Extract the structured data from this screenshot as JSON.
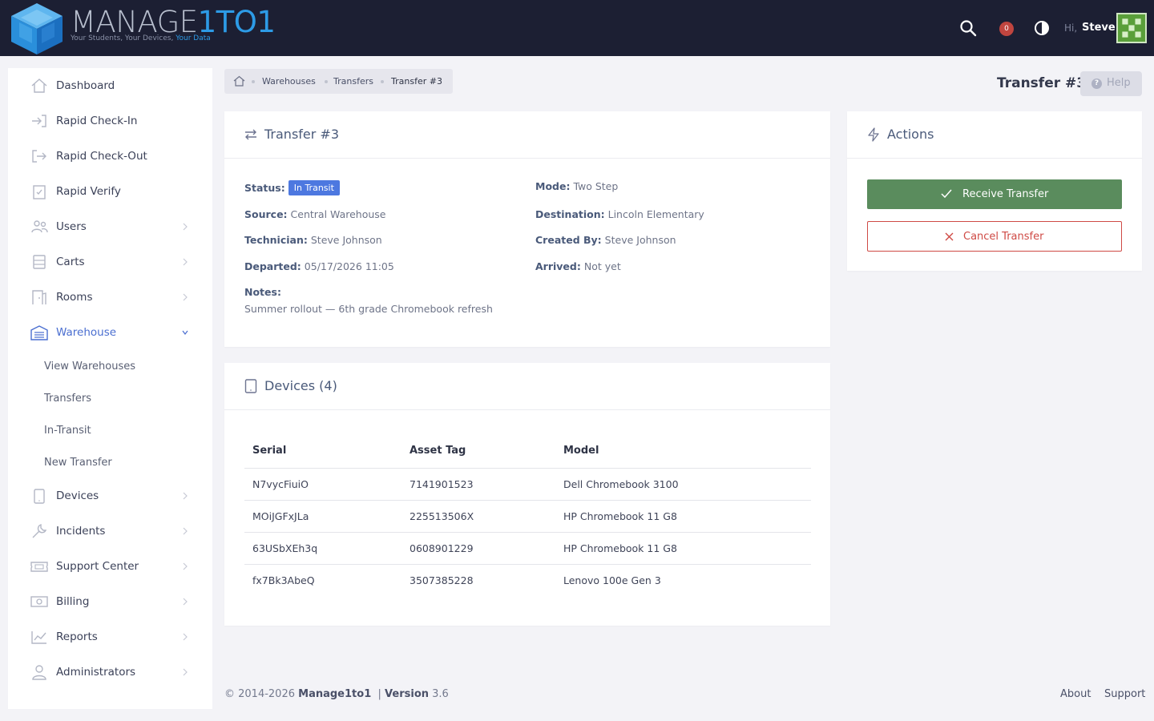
{
  "app": {
    "logo_word_1": "MANAGE",
    "logo_word_2": "1TO1",
    "logo_tag": "Your Students, Your Devices,",
    "logo_tag_accent": "Your Data"
  },
  "topbar": {
    "notification_count": "0",
    "greeting": "Hi,",
    "user_name": "Steve",
    "icons": [
      "search-icon",
      "bell-badge",
      "theme-toggle-icon",
      "avatar"
    ]
  },
  "sidebar": {
    "items": [
      {
        "label": "Dashboard",
        "icon": "home-icon"
      },
      {
        "label": "Rapid Check-In",
        "icon": "sign-in-icon"
      },
      {
        "label": "Rapid Check-Out",
        "icon": "sign-out-icon"
      },
      {
        "label": "Rapid Verify",
        "icon": "clipboard-check-icon"
      },
      {
        "label": "Users",
        "icon": "users-icon"
      },
      {
        "label": "Carts",
        "icon": "cart-icon"
      },
      {
        "label": "Rooms",
        "icon": "door-icon"
      },
      {
        "label": "Warehouse",
        "icon": "warehouse-icon"
      },
      {
        "label": "Devices",
        "icon": "tablet-icon"
      },
      {
        "label": "Incidents",
        "icon": "wrench-icon"
      },
      {
        "label": "Support Center",
        "icon": "ticket-icon"
      },
      {
        "label": "Billing",
        "icon": "money-icon"
      },
      {
        "label": "Reports",
        "icon": "chart-icon"
      },
      {
        "label": "Administrators",
        "icon": "admin-icon"
      }
    ],
    "warehouse_sub": [
      "View Warehouses",
      "Transfers",
      "In-Transit",
      "New Transfer"
    ]
  },
  "breadcrumb": [
    "Warehouses",
    "Transfers",
    "Transfer #3"
  ],
  "page": {
    "title": "Transfer #3",
    "help_label": "Help"
  },
  "transfer_card": {
    "title": "Transfer #3",
    "status_label": "Status:",
    "status_value": "In Transit",
    "mode_label": "Mode:",
    "mode_value": "Two Step",
    "source_label": "Source:",
    "source_value": "Central Warehouse",
    "destination_label": "Destination:",
    "destination_value": "Lincoln Elementary",
    "technician_label": "Technician:",
    "technician_value": "Steve Johnson",
    "created_by_label": "Created By:",
    "created_by_value": "Steve Johnson",
    "departed_label": "Departed:",
    "departed_value": "05/17/2026 11:05",
    "arrived_label": "Arrived:",
    "arrived_value": "Not yet",
    "notes_label": "Notes:",
    "notes_value": "Summer rollout — 6th grade Chromebook refresh"
  },
  "devices_card": {
    "title": "Devices (4)",
    "columns": [
      "Serial",
      "Asset Tag",
      "Model"
    ],
    "rows": [
      [
        "N7vycFiuiO",
        "7141901523",
        "Dell Chromebook 3100"
      ],
      [
        "MOiJGFxJLa",
        "225513506X",
        "HP Chromebook 11 G8"
      ],
      [
        "63USbXEh3q",
        "0608901229",
        "HP Chromebook 11 G8"
      ],
      [
        "fx7Bk3AbeQ",
        "3507385228",
        "Lenovo 100e Gen 3"
      ]
    ]
  },
  "actions_card": {
    "title": "Actions",
    "receive_label": "Receive Transfer",
    "cancel_label": "Cancel Transfer"
  },
  "footer": {
    "copyright": "© 2014-2026",
    "brand": "Manage1to1",
    "sep": "|",
    "version_label": "Version",
    "version_value": "3.6",
    "links": [
      "About",
      "Support"
    ]
  },
  "colors": {
    "topbar": "#1c1f33",
    "accent_blue": "#4a6ed0",
    "status_badge": "#4d78e0",
    "receive_green": "#5a8c5d",
    "cancel_red": "#cf4a45"
  }
}
